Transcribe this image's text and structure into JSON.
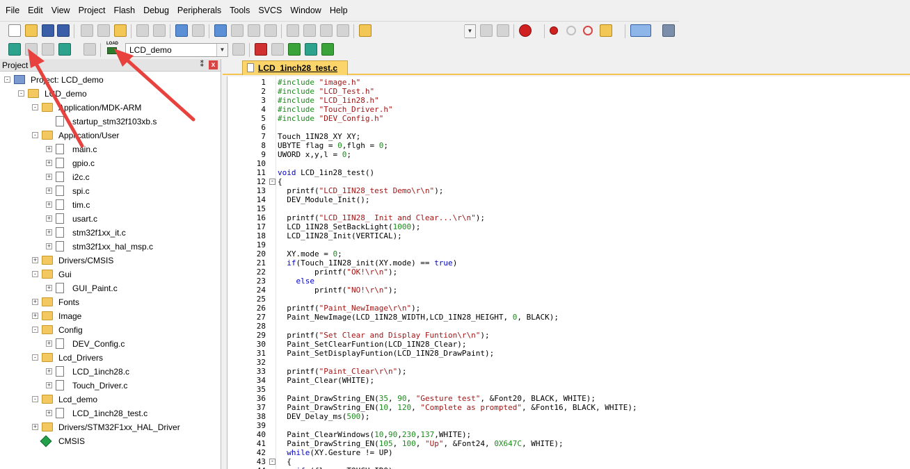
{
  "menu": [
    "File",
    "Edit",
    "View",
    "Project",
    "Flash",
    "Debug",
    "Peripherals",
    "Tools",
    "SVCS",
    "Window",
    "Help"
  ],
  "toolbar2": {
    "load_label": "LOAD",
    "target_name": "LCD_demo"
  },
  "project_panel": {
    "title": "Project",
    "pin": "⁑",
    "close": "x"
  },
  "tree": [
    {
      "label": "Project: LCD_demo",
      "type": "project",
      "level": 0,
      "expand": "-"
    },
    {
      "label": "LCD_demo",
      "type": "target",
      "level": 1,
      "expand": "-"
    },
    {
      "label": "Application/MDK-ARM",
      "type": "folder",
      "level": 2,
      "expand": "-"
    },
    {
      "label": "startup_stm32f103xb.s",
      "type": "file",
      "level": 3,
      "expand": ""
    },
    {
      "label": "Application/User",
      "type": "folder",
      "level": 2,
      "expand": "-"
    },
    {
      "label": "main.c",
      "type": "file",
      "level": 3,
      "expand": "+"
    },
    {
      "label": "gpio.c",
      "type": "file",
      "level": 3,
      "expand": "+"
    },
    {
      "label": "i2c.c",
      "type": "file",
      "level": 3,
      "expand": "+"
    },
    {
      "label": "spi.c",
      "type": "file",
      "level": 3,
      "expand": "+"
    },
    {
      "label": "tim.c",
      "type": "file",
      "level": 3,
      "expand": "+"
    },
    {
      "label": "usart.c",
      "type": "file",
      "level": 3,
      "expand": "+"
    },
    {
      "label": "stm32f1xx_it.c",
      "type": "file",
      "level": 3,
      "expand": "+"
    },
    {
      "label": "stm32f1xx_hal_msp.c",
      "type": "file",
      "level": 3,
      "expand": "+"
    },
    {
      "label": "Drivers/CMSIS",
      "type": "folder",
      "level": 2,
      "expand": "+"
    },
    {
      "label": "Gui",
      "type": "folder",
      "level": 2,
      "expand": "-"
    },
    {
      "label": "GUI_Paint.c",
      "type": "file",
      "level": 3,
      "expand": "+"
    },
    {
      "label": "Fonts",
      "type": "folder",
      "level": 2,
      "expand": "+"
    },
    {
      "label": "Image",
      "type": "folder",
      "level": 2,
      "expand": "+"
    },
    {
      "label": "Config",
      "type": "folder",
      "level": 2,
      "expand": "-"
    },
    {
      "label": "DEV_Config.c",
      "type": "file",
      "level": 3,
      "expand": "+"
    },
    {
      "label": "Lcd_Drivers",
      "type": "folder",
      "level": 2,
      "expand": "-"
    },
    {
      "label": "LCD_1inch28.c",
      "type": "file",
      "level": 3,
      "expand": "+"
    },
    {
      "label": "Touch_Driver.c",
      "type": "file",
      "level": 3,
      "expand": "+"
    },
    {
      "label": "Lcd_demo",
      "type": "folder",
      "level": 2,
      "expand": "-"
    },
    {
      "label": "LCD_1inch28_test.c",
      "type": "file",
      "level": 3,
      "expand": "+"
    },
    {
      "label": "Drivers/STM32F1xx_HAL_Driver",
      "type": "folder",
      "level": 2,
      "expand": "+"
    },
    {
      "label": "CMSIS",
      "type": "cmsis",
      "level": 2,
      "expand": ""
    }
  ],
  "editor": {
    "tab_label": "LCD_1inch28_test.c"
  },
  "code": [
    {
      "n": "1",
      "t": "#include \"image.h\"",
      "fold": ""
    },
    {
      "n": "2",
      "t": "#include \"LCD_Test.h\"",
      "fold": ""
    },
    {
      "n": "3",
      "t": "#include \"LCD_1in28.h\"",
      "fold": ""
    },
    {
      "n": "4",
      "t": "#include \"Touch_Driver.h\"",
      "fold": ""
    },
    {
      "n": "5",
      "t": "#include \"DEV_Config.h\"",
      "fold": ""
    },
    {
      "n": "6",
      "t": "",
      "fold": ""
    },
    {
      "n": "7",
      "t": "Touch_1IN28_XY XY;",
      "fold": ""
    },
    {
      "n": "8",
      "t": "UBYTE flag = 0,flgh = 0;",
      "fold": ""
    },
    {
      "n": "9",
      "t": "UWORD x,y,l = 0;",
      "fold": ""
    },
    {
      "n": "10",
      "t": "",
      "fold": ""
    },
    {
      "n": "11",
      "t": "void LCD_1in28_test()",
      "fold": ""
    },
    {
      "n": "12",
      "t": "{",
      "fold": "-"
    },
    {
      "n": "13",
      "t": "  printf(\"LCD_1IN28_test Demo\\r\\n\");",
      "fold": ""
    },
    {
      "n": "14",
      "t": "  DEV_Module_Init();",
      "fold": ""
    },
    {
      "n": "15",
      "t": "",
      "fold": ""
    },
    {
      "n": "16",
      "t": "  printf(\"LCD_1IN28_ Init and Clear...\\r\\n\");",
      "fold": ""
    },
    {
      "n": "17",
      "t": "  LCD_1IN28_SetBackLight(1000);",
      "fold": ""
    },
    {
      "n": "18",
      "t": "  LCD_1IN28_Init(VERTICAL);",
      "fold": ""
    },
    {
      "n": "19",
      "t": "",
      "fold": ""
    },
    {
      "n": "20",
      "t": "  XY.mode = 0;",
      "fold": ""
    },
    {
      "n": "21",
      "t": "  if(Touch_1IN28_init(XY.mode) == true)",
      "fold": ""
    },
    {
      "n": "22",
      "t": "        printf(\"OK!\\r\\n\");",
      "fold": ""
    },
    {
      "n": "23",
      "t": "    else",
      "fold": ""
    },
    {
      "n": "24",
      "t": "        printf(\"NO!\\r\\n\");",
      "fold": ""
    },
    {
      "n": "25",
      "t": "",
      "fold": ""
    },
    {
      "n": "26",
      "t": "  printf(\"Paint_NewImage\\r\\n\");",
      "fold": ""
    },
    {
      "n": "27",
      "t": "  Paint_NewImage(LCD_1IN28_WIDTH,LCD_1IN28_HEIGHT, 0, BLACK);",
      "fold": ""
    },
    {
      "n": "28",
      "t": "",
      "fold": ""
    },
    {
      "n": "29",
      "t": "  printf(\"Set Clear and Display Funtion\\r\\n\");",
      "fold": ""
    },
    {
      "n": "30",
      "t": "  Paint_SetClearFuntion(LCD_1IN28_Clear);",
      "fold": ""
    },
    {
      "n": "31",
      "t": "  Paint_SetDisplayFuntion(LCD_1IN28_DrawPaint);",
      "fold": ""
    },
    {
      "n": "32",
      "t": "",
      "fold": ""
    },
    {
      "n": "33",
      "t": "  printf(\"Paint_Clear\\r\\n\");",
      "fold": ""
    },
    {
      "n": "34",
      "t": "  Paint_Clear(WHITE);",
      "fold": ""
    },
    {
      "n": "35",
      "t": "",
      "fold": ""
    },
    {
      "n": "36",
      "t": "  Paint_DrawString_EN(35, 90, \"Gesture test\", &Font20, BLACK, WHITE);",
      "fold": ""
    },
    {
      "n": "37",
      "t": "  Paint_DrawString_EN(10, 120, \"Complete as prompted\", &Font16, BLACK, WHITE);",
      "fold": ""
    },
    {
      "n": "38",
      "t": "  DEV_Delay_ms(500);",
      "fold": ""
    },
    {
      "n": "39",
      "t": "",
      "fold": ""
    },
    {
      "n": "40",
      "t": "  Paint_ClearWindows(10,90,230,137,WHITE);",
      "fold": ""
    },
    {
      "n": "41",
      "t": "  Paint_DrawString_EN(105, 100, \"Up\", &Font24, 0X647C, WHITE);",
      "fold": ""
    },
    {
      "n": "42",
      "t": "  while(XY.Gesture != UP)",
      "fold": ""
    },
    {
      "n": "43",
      "t": "  {",
      "fold": "-"
    },
    {
      "n": "44",
      "t": "    if (flag   TOUCH_IRQ)",
      "fold": ""
    }
  ],
  "colors": {
    "tab_active": "#fbd56a",
    "tab_border": "#f7c44f",
    "annotation_arrow": "#e8423f"
  }
}
